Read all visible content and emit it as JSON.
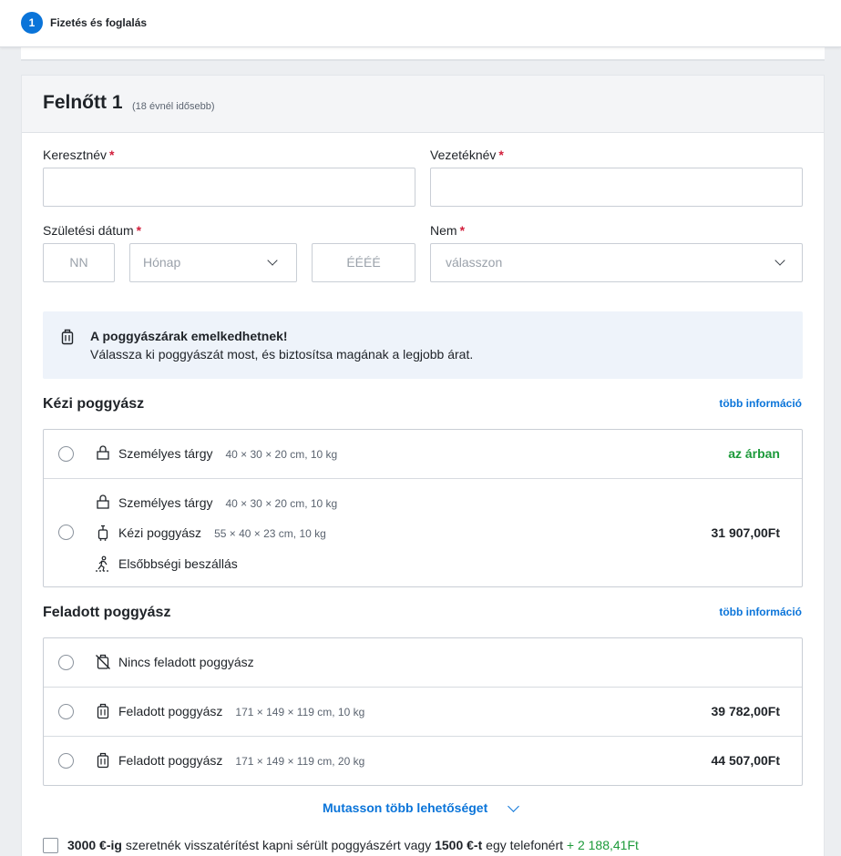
{
  "stepper": {
    "number": "1",
    "label": "Fizetés és foglalás"
  },
  "passenger": {
    "title": "Felnőtt 1",
    "subtitle": "(18 évnél idősebb)"
  },
  "form": {
    "first_name": {
      "label": "Keresztnév",
      "required_mark": "*",
      "value": ""
    },
    "last_name": {
      "label": "Vezetéknév",
      "required_mark": "*",
      "value": ""
    },
    "birth_date": {
      "label": "Születési dátum",
      "required_mark": "*",
      "day_placeholder": "NN",
      "month_placeholder": "Hónap",
      "year_placeholder": "ÉÉÉÉ"
    },
    "gender": {
      "label": "Nem",
      "required_mark": "*",
      "placeholder": "válasszon"
    }
  },
  "notice": {
    "icon": "luggage-icon",
    "title": "A poggyászárak emelkedhetnek!",
    "text": "Válassza ki poggyászát most, és biztosítsa magának a legjobb árat."
  },
  "cabin_baggage": {
    "title": "Kézi poggyász",
    "more_info": "több információ",
    "options": [
      {
        "items": [
          {
            "icon": "personal-bag-icon",
            "label": "Személyes tárgy",
            "dims": "40 × 30 × 20 cm, 10 kg"
          }
        ],
        "price": "az árban"
      },
      {
        "items": [
          {
            "icon": "personal-bag-icon",
            "label": "Személyes tárgy",
            "dims": "40 × 30 × 20 cm, 10 kg"
          },
          {
            "icon": "trolley-icon",
            "label": "Kézi poggyász",
            "dims": "55 × 40 × 23 cm, 10 kg"
          },
          {
            "icon": "priority-boarding-icon",
            "label": "Elsőbbségi beszállás",
            "dims": ""
          }
        ],
        "price": "31 907,00Ft"
      }
    ]
  },
  "checked_baggage": {
    "title": "Feladott poggyász",
    "more_info": "több információ",
    "options": [
      {
        "icon": "no-luggage-icon",
        "label": "Nincs feladott poggyász",
        "dims": "",
        "price": ""
      },
      {
        "icon": "suitcase-icon",
        "label": "Feladott poggyász",
        "dims": "171 × 149 × 119 cm, 10 kg",
        "price": "39 782,00Ft"
      },
      {
        "icon": "suitcase-icon",
        "label": "Feladott poggyász",
        "dims": "171 × 149 × 119 cm, 20 kg",
        "price": "44 507,00Ft"
      }
    ]
  },
  "show_more": "Mutasson több lehetőséget",
  "insurance": {
    "amount1": "3000 €-ig",
    "text1": "szeretnék visszatérítést kapni sérült poggyászért vagy",
    "amount2": "1500 €-t",
    "text2": "egy telefonért",
    "price": "+ 2 188,41Ft"
  },
  "colors": {
    "accent": "#0a74d9",
    "required": "#d21f3c",
    "included": "#1c9a3a"
  }
}
